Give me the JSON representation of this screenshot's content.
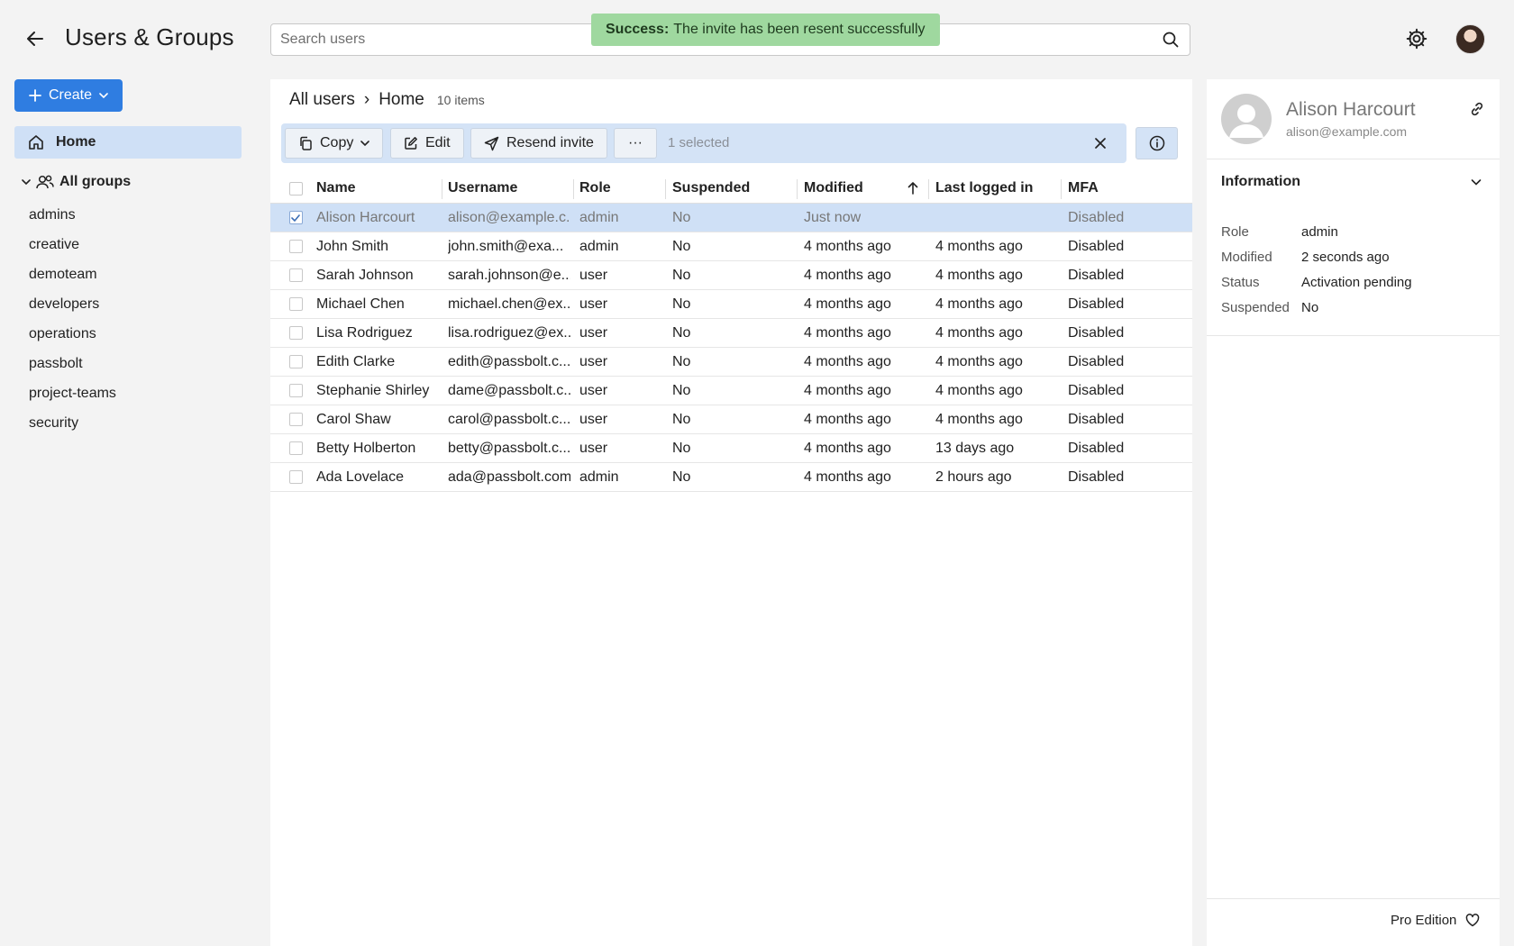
{
  "header": {
    "title": "Users & Groups",
    "search_placeholder": "Search users",
    "toast_label": "Success:",
    "toast_message": "The invite has been resent successfully"
  },
  "sidebar": {
    "create_label": "Create",
    "home_label": "Home",
    "all_groups_label": "All groups",
    "groups": [
      "admins",
      "creative",
      "demoteam",
      "developers",
      "operations",
      "passbolt",
      "project-teams",
      "security"
    ]
  },
  "main": {
    "breadcrumb": [
      "All users",
      "Home"
    ],
    "breadcrumb_separator": "›",
    "item_count": "10 items",
    "toolbar": {
      "copy_label": "Copy",
      "edit_label": "Edit",
      "resend_label": "Resend invite",
      "more_label": "···",
      "selected_text": "1 selected"
    },
    "columns": [
      "Name",
      "Username",
      "Role",
      "Suspended",
      "Modified",
      "Last logged in",
      "MFA"
    ],
    "rows": [
      {
        "name": "Alison Harcourt",
        "username": "alison@example.c...",
        "role": "admin",
        "suspended": "No",
        "modified": "Just now",
        "last": "",
        "mfa": "Disabled",
        "selected": true
      },
      {
        "name": "John Smith",
        "username": "john.smith@exa...",
        "role": "admin",
        "suspended": "No",
        "modified": "4 months ago",
        "last": "4 months ago",
        "mfa": "Disabled"
      },
      {
        "name": "Sarah Johnson",
        "username": "sarah.johnson@e...",
        "role": "user",
        "suspended": "No",
        "modified": "4 months ago",
        "last": "4 months ago",
        "mfa": "Disabled"
      },
      {
        "name": "Michael Chen",
        "username": "michael.chen@ex...",
        "role": "user",
        "suspended": "No",
        "modified": "4 months ago",
        "last": "4 months ago",
        "mfa": "Disabled"
      },
      {
        "name": "Lisa Rodriguez",
        "username": "lisa.rodriguez@ex...",
        "role": "user",
        "suspended": "No",
        "modified": "4 months ago",
        "last": "4 months ago",
        "mfa": "Disabled"
      },
      {
        "name": "Edith Clarke",
        "username": "edith@passbolt.c...",
        "role": "user",
        "suspended": "No",
        "modified": "4 months ago",
        "last": "4 months ago",
        "mfa": "Disabled"
      },
      {
        "name": "Stephanie Shirley",
        "username": "dame@passbolt.c...",
        "role": "user",
        "suspended": "No",
        "modified": "4 months ago",
        "last": "4 months ago",
        "mfa": "Disabled"
      },
      {
        "name": "Carol Shaw",
        "username": "carol@passbolt.c...",
        "role": "user",
        "suspended": "No",
        "modified": "4 months ago",
        "last": "4 months ago",
        "mfa": "Disabled"
      },
      {
        "name": "Betty Holberton",
        "username": "betty@passbolt.c...",
        "role": "user",
        "suspended": "No",
        "modified": "4 months ago",
        "last": "13 days ago",
        "mfa": "Disabled"
      },
      {
        "name": "Ada Lovelace",
        "username": "ada@passbolt.com",
        "role": "admin",
        "suspended": "No",
        "modified": "4 months ago",
        "last": "2 hours ago",
        "mfa": "Disabled"
      }
    ]
  },
  "details": {
    "name": "Alison Harcourt",
    "email": "alison@example.com",
    "section_title": "Information",
    "info": [
      {
        "key": "Role",
        "value": "admin"
      },
      {
        "key": "Modified",
        "value": "2 seconds ago"
      },
      {
        "key": "Status",
        "value": "Activation pending"
      },
      {
        "key": "Suspended",
        "value": "No"
      }
    ],
    "edition": "Pro Edition"
  },
  "colors": {
    "accent": "#2f7de1",
    "selection": "#cfe0f6",
    "toast": "#9fd89f"
  }
}
